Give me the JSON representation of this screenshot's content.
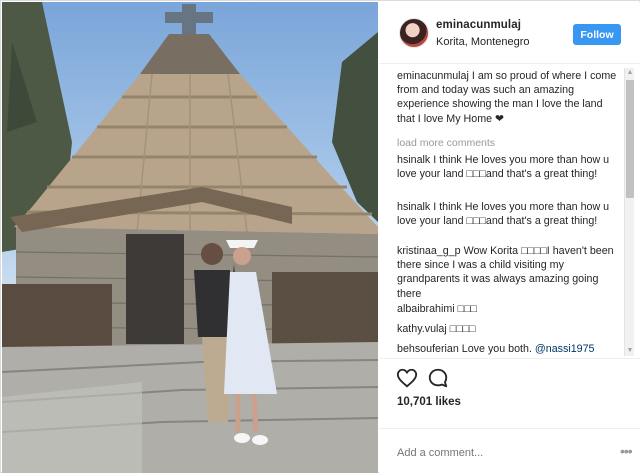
{
  "header": {
    "username": "eminacunmulaj",
    "location": "Korita, Montenegro",
    "follow_label": "Follow"
  },
  "caption": {
    "username": "eminacunmulaj",
    "text": "I am so proud of where I come from and today was such an amazing experience showing the man I love the land that I love My Home ❤"
  },
  "load_more_label": "load more comments",
  "comments": [
    {
      "username": "hsinalk",
      "text": "I think He loves you more than how u love your land □□□and that's a great thing!"
    },
    {
      "username": "hsinalk",
      "text": "I think He loves you more than how u love your land □□□and that's a great thing!"
    },
    {
      "username": "kristinaa_g_p",
      "text": "Wow Korita □□□□I haven't been there since I was a child visiting my grandparents it was always amazing going there"
    },
    {
      "username": "albaibrahimi",
      "text": "□□□"
    },
    {
      "username": "kathy.vulaj",
      "text": "□□□□"
    },
    {
      "username": "behsouferian",
      "text": "Love you both.",
      "mention": "@nassi1975"
    }
  ],
  "actions": {
    "like_icon": "heart-icon",
    "comment_icon": "comment-bubble-icon"
  },
  "likes": "10,701 likes",
  "add_comment_placeholder": "Add a comment...",
  "more_options_label": "•••",
  "scrollbar": {
    "up_glyph": "▲",
    "down_glyph": "▼"
  },
  "colors": {
    "follow_bg": "#3897f0",
    "text": "#262626",
    "muted": "#999999",
    "mention": "#003569"
  }
}
